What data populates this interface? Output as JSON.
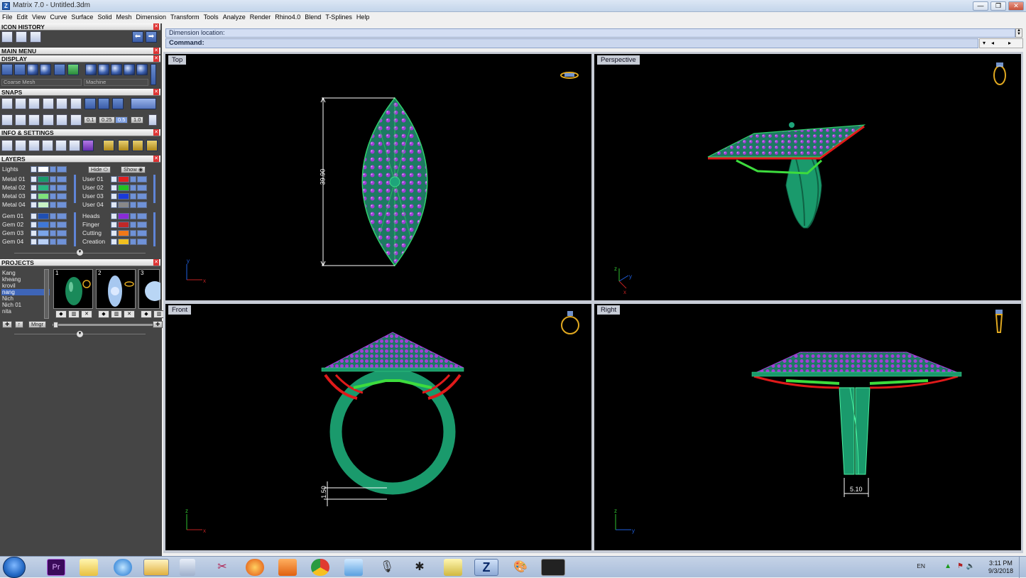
{
  "window": {
    "title": "Matrix 7.0 - Untitled.3dm",
    "app_icon_letter": "Z",
    "controls": {
      "minimize": "—",
      "restore": "❐",
      "close": "✕"
    }
  },
  "menu": [
    "File",
    "Edit",
    "View",
    "Curve",
    "Surface",
    "Solid",
    "Mesh",
    "Dimension",
    "Transform",
    "Tools",
    "Analyze",
    "Render",
    "Rhino4.0",
    "Blend",
    "T-Splines",
    "Help"
  ],
  "panels": {
    "icon_history": "ICON HISTORY",
    "main_menu": "MAIN MENU",
    "display": "DISPLAY",
    "snaps": "SNAPS",
    "info_settings": "INFO & SETTINGS",
    "layers": "LAYERS",
    "projects": "PROJECTS"
  },
  "display": {
    "mesh_select": "Coarse Mesh",
    "material_select": "Machine"
  },
  "snaps": {
    "values": [
      "0.1",
      "0.25",
      "0.5",
      "1.0"
    ]
  },
  "layers": {
    "lights_label": "Lights",
    "hide_label": "Hide",
    "show_label": "Show",
    "left": [
      {
        "name": "Metal 01",
        "color": "#1a9a6a"
      },
      {
        "name": "Metal 02",
        "color": "#2ab67f"
      },
      {
        "name": "Metal 03",
        "color": "#7fe27a"
      },
      {
        "name": "Metal 04",
        "color": "#c9f3c4"
      },
      {
        "name": "Gem 01",
        "color": "#1f4fb3"
      },
      {
        "name": "Gem 02",
        "color": "#3f78d8"
      },
      {
        "name": "Gem 03",
        "color": "#7ba5ea"
      },
      {
        "name": "Gem 04",
        "color": "#b9d0f5"
      }
    ],
    "right": [
      {
        "name": "User 01",
        "color": "#e02020"
      },
      {
        "name": "User 02",
        "color": "#22c022"
      },
      {
        "name": "User 03",
        "color": "#1a3ad8"
      },
      {
        "name": "User 04",
        "color": "#888888"
      },
      {
        "name": "Heads",
        "color": "#8a2bd6"
      },
      {
        "name": "Finger",
        "color": "#c02828"
      },
      {
        "name": "Cutting",
        "color": "#f07818"
      },
      {
        "name": "Creation",
        "color": "#f0c020"
      }
    ]
  },
  "projects": {
    "items": [
      "Kang",
      "kheang",
      "krovil",
      "nang",
      "Nich",
      "Nich 01",
      "nita"
    ],
    "selected": "nang",
    "thumbnails": [
      "1",
      "2",
      "3"
    ],
    "mngr_label": "Mngr"
  },
  "command": {
    "prompt_line": "Dimension location:",
    "command_label": "Command:"
  },
  "viewports": {
    "top": {
      "label": "Top",
      "dimension": "39.90"
    },
    "perspective": {
      "label": "Perspective"
    },
    "front": {
      "label": "Front",
      "dimension": "1.50"
    },
    "right": {
      "label": "Right",
      "dimension": "5.10"
    }
  },
  "colors": {
    "metal_green": "#1d9a6c",
    "gem_purple": "#a23ed8",
    "head_red": "#e01a1a",
    "prong_green": "#3ddc3d"
  },
  "taskbar": {
    "language": "EN",
    "time": "3:11 PM",
    "date": "9/3/2018"
  }
}
